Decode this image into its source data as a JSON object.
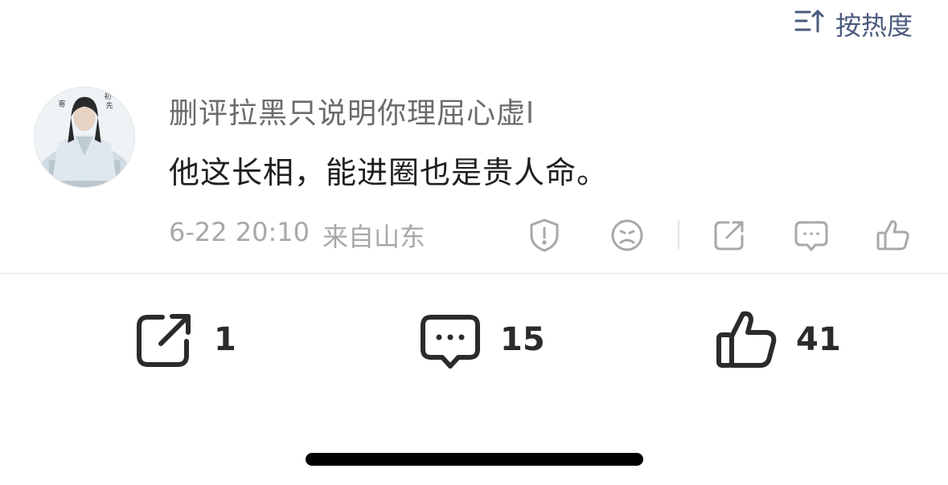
{
  "sort": {
    "label": "按热度",
    "icon": "sort-icon"
  },
  "comment": {
    "avatar_icon": "avatar",
    "username": "删评拉黑只说明你理屈心虚l",
    "text": "他这长相，能进圈也是贵人命。",
    "date": "6-22 20:10",
    "location": "来自山东",
    "actions": [
      "report-icon",
      "dislike-icon",
      "share-icon",
      "reply-icon",
      "like-icon"
    ]
  },
  "bottom_bar": {
    "share_count": "1",
    "comment_count": "15",
    "like_count": "41"
  },
  "colors": {
    "accent": "#4a5b7d",
    "icon_gray": "#a8a8a8",
    "icon_dark": "#2b2b2b",
    "meta_text": "#a8a8a8"
  }
}
